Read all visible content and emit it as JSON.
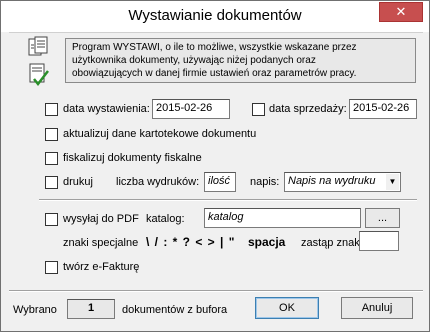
{
  "window": {
    "title": "Wystawianie dokumentów",
    "close_glyph": "✕"
  },
  "info": {
    "text_line1": "Program WYSTAWI, o ile to możliwe, wszystkie wskazane przez",
    "text_line2": "użytkownika dokumenty, używając niżej podanych oraz",
    "text_line3": "obowiązujących w danej firmie ustawień oraz parametrów pracy."
  },
  "options": {
    "data_wystawienia": {
      "label": "data wystawienia:",
      "checked": false,
      "value": "2015-02-26"
    },
    "data_sprzedazy": {
      "label": "data sprzedaży:",
      "checked": false,
      "value": "2015-02-26"
    },
    "aktualizuj": {
      "label": "aktualizuj dane kartotekowe dokumentu",
      "checked": false
    },
    "fiskalizuj": {
      "label": "fiskalizuj dokumenty fiskalne",
      "checked": false
    },
    "drukuj": {
      "label": "drukuj",
      "checked": false
    },
    "liczba_wydrukow": {
      "label": "liczba wydruków:",
      "value": "ilość"
    },
    "napis": {
      "label": "napis:",
      "value": "Napis na wydruku"
    },
    "wysylaj_pdf": {
      "label": "wysyłaj do PDF",
      "checked": false
    },
    "katalog": {
      "label": "katalog:",
      "value": "katalog",
      "browse_label": "..."
    },
    "znaki": {
      "label": "znaki specjalne",
      "chars": "\\ / : * ? < > | \"",
      "spacja": "spacja",
      "zastap_label": "zastąp znakiem:",
      "zastap_value": ""
    },
    "efaktura": {
      "label": "twórz e-Fakturę",
      "checked": false
    }
  },
  "footer": {
    "wybrano_label": "Wybrano",
    "count": "1",
    "suffix": "dokumentów z bufora",
    "ok_label": "OK",
    "cancel_label": "Anuluj"
  }
}
